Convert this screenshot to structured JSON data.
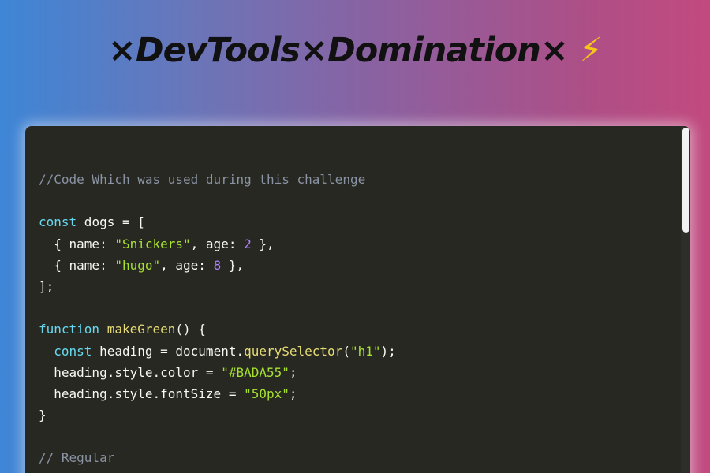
{
  "page": {
    "title": "×DevTools×Domination×",
    "title_icon": "lightning-bolt-icon",
    "title_icon_glyph": "⚡"
  },
  "colors": {
    "gradient_left": "#3e86d6",
    "gradient_right": "#c24a7f",
    "code_background": "#272822",
    "comment": "#8a93a4",
    "keyword": "#66d9ef",
    "string": "#a6e22e",
    "number": "#ae81ff",
    "function": "#e6db74",
    "text": "#f8f8f2"
  },
  "code_lines": [
    [
      {
        "t": "c",
        "v": "//Code Which was used during this challenge"
      }
    ],
    [],
    [
      {
        "t": "k",
        "v": "const"
      },
      {
        "t": "t",
        "v": " dogs = ["
      }
    ],
    [
      {
        "t": "t",
        "v": "  { name: "
      },
      {
        "t": "s",
        "v": "\"Snickers\""
      },
      {
        "t": "t",
        "v": ", age: "
      },
      {
        "t": "n",
        "v": "2"
      },
      {
        "t": "t",
        "v": " },"
      }
    ],
    [
      {
        "t": "t",
        "v": "  { name: "
      },
      {
        "t": "s",
        "v": "\"hugo\""
      },
      {
        "t": "t",
        "v": ", age: "
      },
      {
        "t": "n",
        "v": "8"
      },
      {
        "t": "t",
        "v": " },"
      }
    ],
    [
      {
        "t": "t",
        "v": "];"
      }
    ],
    [],
    [
      {
        "t": "k",
        "v": "function"
      },
      {
        "t": "t",
        "v": " "
      },
      {
        "t": "f",
        "v": "makeGreen"
      },
      {
        "t": "t",
        "v": "() {"
      }
    ],
    [
      {
        "t": "t",
        "v": "  "
      },
      {
        "t": "k",
        "v": "const"
      },
      {
        "t": "t",
        "v": " heading = document."
      },
      {
        "t": "f",
        "v": "querySelector"
      },
      {
        "t": "t",
        "v": "("
      },
      {
        "t": "s",
        "v": "\"h1\""
      },
      {
        "t": "t",
        "v": ");"
      }
    ],
    [
      {
        "t": "t",
        "v": "  heading.style.color = "
      },
      {
        "t": "s",
        "v": "\"#BADA55\""
      },
      {
        "t": "t",
        "v": ";"
      }
    ],
    [
      {
        "t": "t",
        "v": "  heading.style.fontSize = "
      },
      {
        "t": "s",
        "v": "\"50px\""
      },
      {
        "t": "t",
        "v": ";"
      }
    ],
    [
      {
        "t": "t",
        "v": "}"
      }
    ],
    [],
    [
      {
        "t": "c",
        "v": "// Regular"
      }
    ]
  ]
}
